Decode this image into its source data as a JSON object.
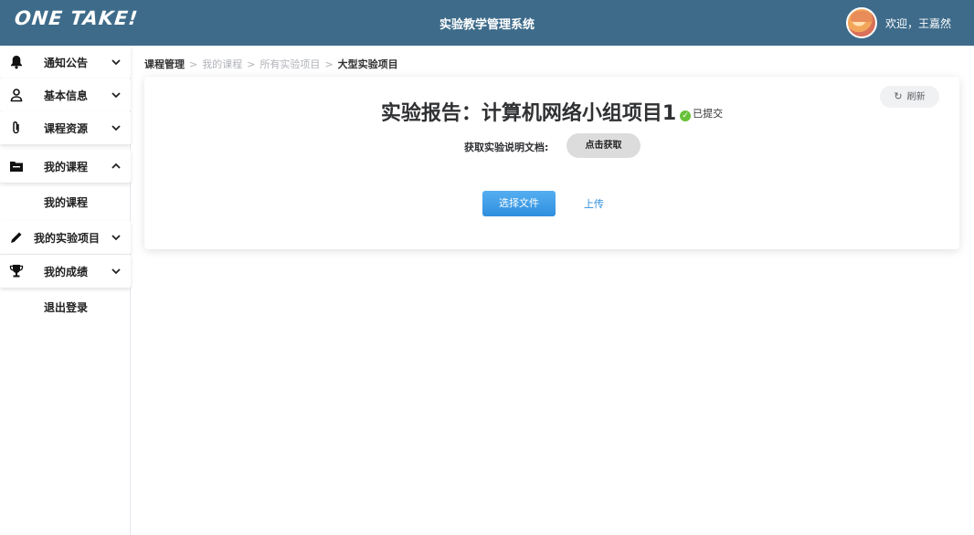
{
  "header": {
    "logo": "ONE TAKE!",
    "title": "实验教学管理系统",
    "welcome": "欢迎，王嘉然",
    "avatar_icon": "avatar-icon"
  },
  "sidebar": {
    "items": [
      {
        "label": "通知公告",
        "icon": "bell-icon",
        "expanded": false
      },
      {
        "label": "基本信息",
        "icon": "user-icon",
        "expanded": false
      },
      {
        "label": "课程资源",
        "icon": "paperclip-icon",
        "expanded": false
      },
      {
        "label": "我的课程",
        "icon": "folder-icon",
        "expanded": true,
        "children": [
          "我的课程"
        ]
      },
      {
        "label": "我的实验项目",
        "icon": "pencil-icon",
        "expanded": false
      },
      {
        "label": "我的成绩",
        "icon": "trophy-icon",
        "expanded": false
      }
    ],
    "logout": "退出登录"
  },
  "breadcrumb": [
    "课程管理",
    "我的课程",
    "所有实验项目",
    "大型实验项目"
  ],
  "breadcrumb_separator": ">",
  "card": {
    "title": "实验报告：计算机网络小组项目1",
    "status": "已提交",
    "status_color": "#67c23a",
    "refresh_label": "刷新",
    "doc_label": "获取实验说明文档:",
    "get_button": "点击获取",
    "choose_file_button": "选择文件",
    "upload_link": "上传"
  },
  "colors": {
    "header_bg": "#3e6b8a",
    "primary": "#2f8fdf"
  }
}
